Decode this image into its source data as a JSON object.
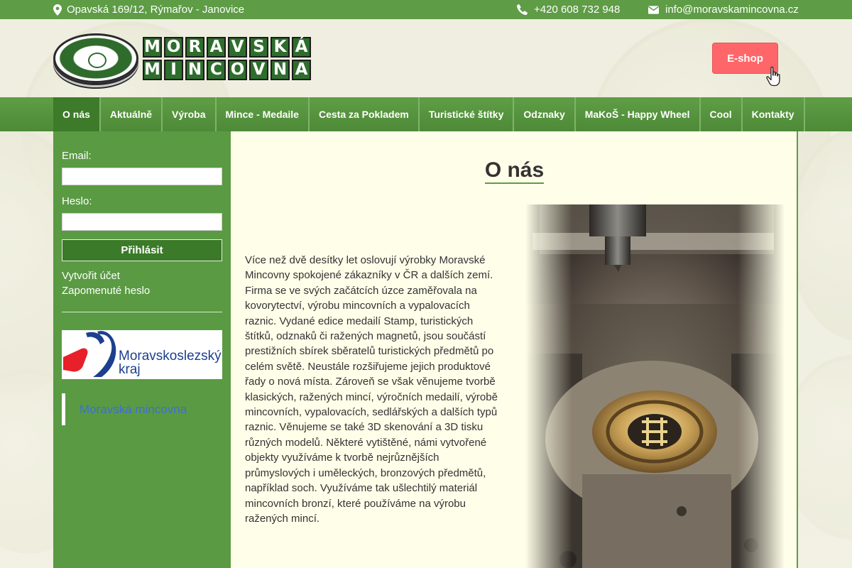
{
  "topbar": {
    "address": "Opavská 169/12, Rýmařov - Janovice",
    "phone": "+420 608 732 948",
    "email": "info@moravskamincovna.cz",
    "icons": {
      "address": "map-marker-icon",
      "phone": "phone-icon",
      "email": "envelope-icon"
    }
  },
  "logo": {
    "line1": [
      "M",
      "O",
      "R",
      "A",
      "V",
      "S",
      "K",
      "Á"
    ],
    "line2": [
      "M",
      "I",
      "N",
      "C",
      "O",
      "V",
      "N",
      "A"
    ]
  },
  "header": {
    "eshop_label": "E-shop"
  },
  "nav": {
    "items": [
      "O nás",
      "Aktuálně",
      "Výroba",
      "Mince - Medaile",
      "Cesta za Pokladem",
      "Turistické štítky",
      "Odznaky",
      "MaKoŠ - Happy Wheel",
      "Cool",
      "Kontakty"
    ],
    "active": "O nás"
  },
  "sidebar": {
    "email_label": "Email:",
    "password_label": "Heslo:",
    "login_button": "Přihlásit",
    "create_account": "Vytvořit účet",
    "forgot_password": "Zapomenuté heslo",
    "region_logo_text_1": "Moravskoslezský",
    "region_logo_text_2": "kraj",
    "quote_link": "Moravská mincovna"
  },
  "main": {
    "title": "O nás",
    "body": "Více než dvě desítky let oslovují výrobky Moravské Mincovny spokojené zákazníky v ČR a dalších zemí. Firma se ve svých začátcích úzce zaměřovala na kovorytectví, výrobu mincovních a vypalovacích raznic. Vydané edice medailí Stamp, turistických štítků, odznaků či ražených magnetů, jsou součástí prestižních sbírek sběratelů turistických předmětů po celém světě. Neustále rozšiřujeme jejich produktové řady o nová místa. Zároveň se však věnujeme tvorbě klasických, ražených mincí, výročních medailí, výrobě mincovních, vypalovacích, sedlářských a dalších typů raznic. Věnujeme se také 3D skenování a 3D tisku různých modelů. Některé vytištěné, námi vytvořené objekty využíváme k tvorbě nejrůznějších průmyslových i uměleckých, bronzových předmětů, například soch. Využíváme tak ušlechtilý materiál mincovních bronzí, které používáme na výrobu ražených mincí."
  },
  "colors": {
    "green": "#5e9c46",
    "dark_green": "#3b7a28",
    "eshop_red": "#ff6669",
    "content_bg": "#fffee9",
    "link_blue": "#3d6fd4"
  }
}
